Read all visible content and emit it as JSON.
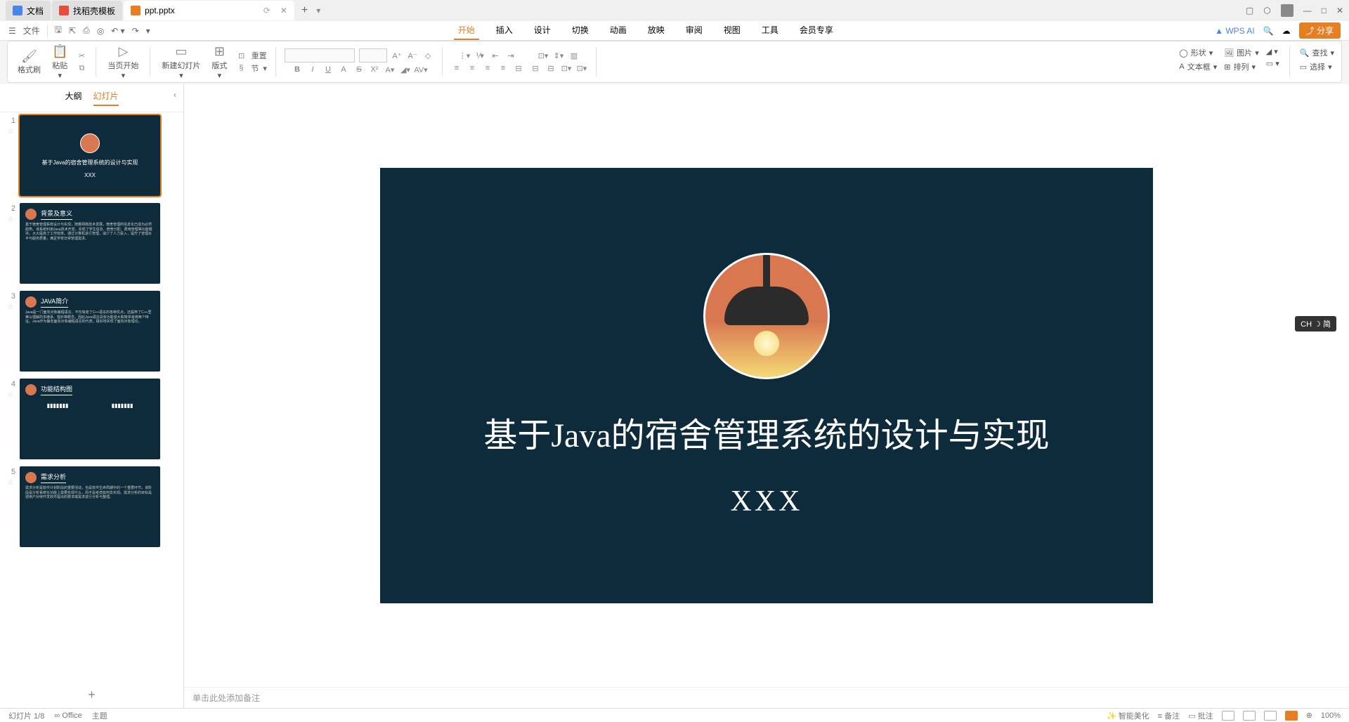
{
  "tabs": [
    {
      "label": "文档",
      "icon": "blue"
    },
    {
      "label": "找稻壳模板",
      "icon": "red"
    },
    {
      "label": "ppt.pptx",
      "icon": "orange",
      "active": true
    }
  ],
  "window": {
    "min": "—",
    "max": "□",
    "close": "✕",
    "cube": "⬚",
    "full": "⛶"
  },
  "menu": {
    "file": "文件"
  },
  "menuTabs": [
    "开始",
    "插入",
    "设计",
    "切换",
    "动画",
    "放映",
    "审阅",
    "视图",
    "工具",
    "会员专享"
  ],
  "menubarRight": {
    "wpsai": "WPS AI",
    "share": "分享"
  },
  "ribbon": {
    "fmtBrush": "格式刷",
    "paste": "粘贴",
    "startPage": "当页开始",
    "newSlide": "新建幻灯片",
    "layout": "版式",
    "reset": "重置",
    "section": "节",
    "shape": "形状",
    "image": "图片",
    "textbox": "文本框",
    "arrange": "排列",
    "find": "查找",
    "select": "选择"
  },
  "panel": {
    "outline": "大纲",
    "slides": "幻灯片"
  },
  "thumbs": [
    {
      "n": 1,
      "type": "title",
      "title": "基于Java的宿舍管理系统的设计与实现",
      "sub": "XXX"
    },
    {
      "n": 2,
      "heading": "背景及意义"
    },
    {
      "n": 3,
      "heading": "JAVA简介"
    },
    {
      "n": 4,
      "heading": "功能结构图"
    },
    {
      "n": 5,
      "heading": "需求分析"
    }
  ],
  "slide": {
    "title": "基于Java的宿舍管理系统的设计与实现",
    "sub": "XXX"
  },
  "notes": "单击此处添加备注",
  "ime": "CH ☽ 简",
  "status": {
    "slide": "幻灯片 1/8",
    "office": "Office",
    "theme": "主题",
    "beautify": "智能美化",
    "remarks": "备注",
    "comments": "批注",
    "zoom": "100%"
  }
}
